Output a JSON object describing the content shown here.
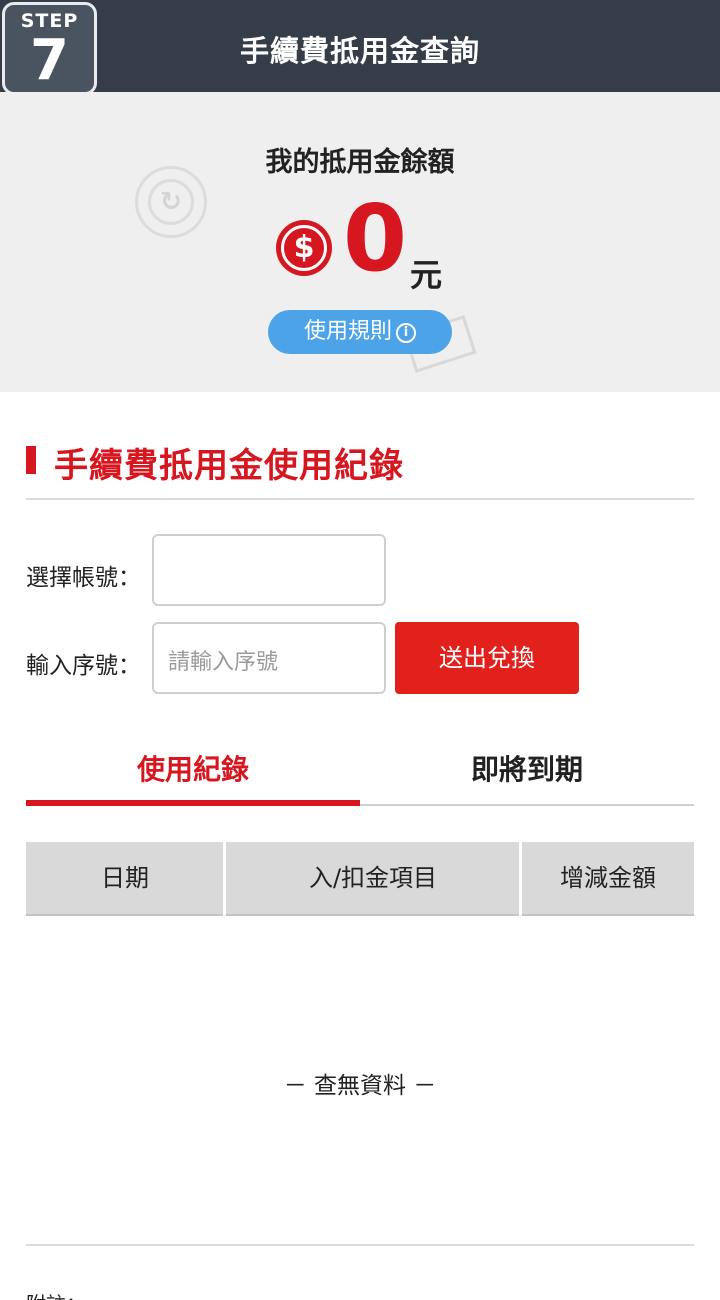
{
  "header": {
    "title": "手續費抵用金查詢",
    "step_label": "STEP",
    "step_number": "7"
  },
  "balance": {
    "title": "我的抵用金餘額",
    "currency_icon": "$",
    "amount": "0",
    "unit": "元",
    "rules_label": "使用規則",
    "rules_icon": "i"
  },
  "section": {
    "title": "手續費抵用金使用紀錄"
  },
  "form": {
    "account_label": "選擇帳號：",
    "account_value": "",
    "serial_label": "輸入序號：",
    "serial_placeholder": "請輸入序號",
    "submit_label": "送出兌換"
  },
  "tabs": [
    {
      "label": "使用紀錄",
      "active": true
    },
    {
      "label": "即將到期",
      "active": false
    }
  ],
  "table": {
    "columns": [
      "日期",
      "入/扣金項目",
      "增減金額"
    ],
    "empty_text": "－ 查無資料 －"
  },
  "footer": {
    "note_label": "附註："
  },
  "colors": {
    "header_bg": "#343d48",
    "accent_red": "#d7171f",
    "button_red": "#e2211c",
    "pill_blue": "#4da3e8"
  }
}
